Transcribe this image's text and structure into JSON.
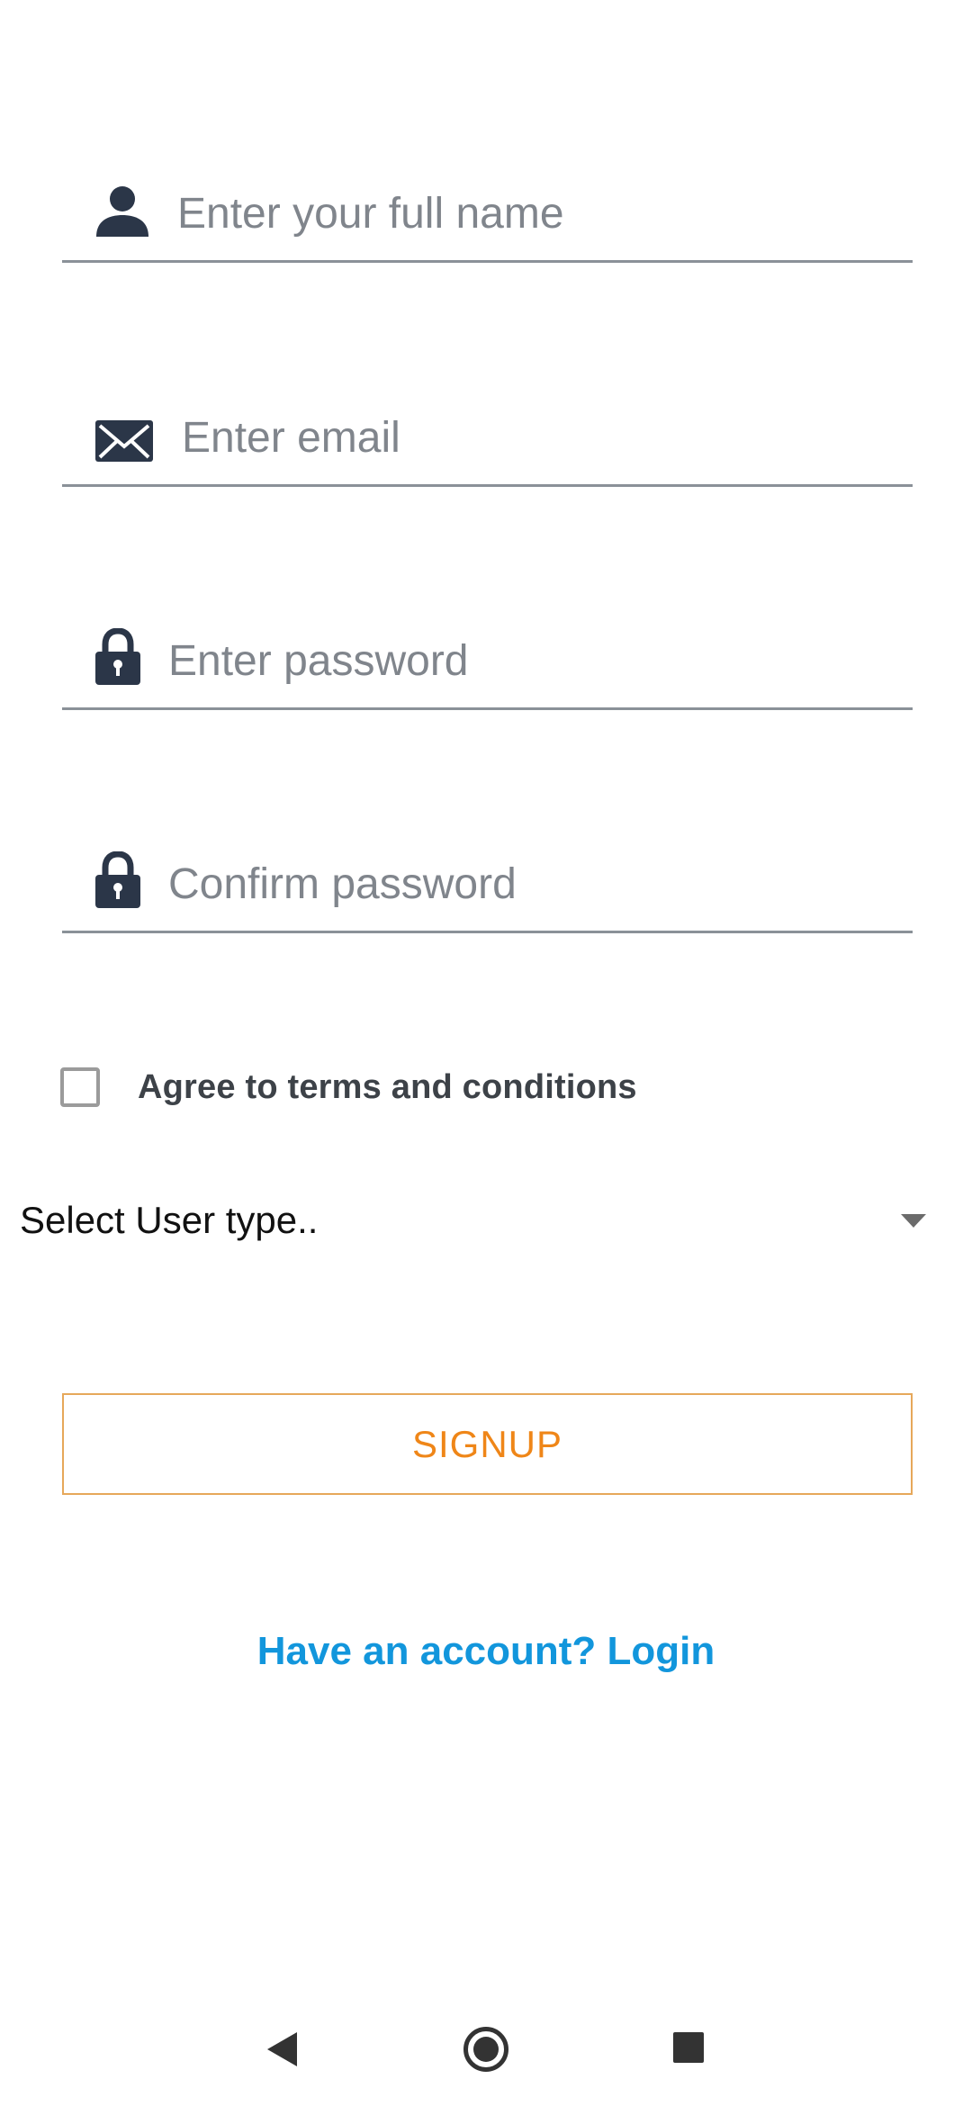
{
  "form": {
    "full_name": {
      "placeholder": "Enter your full name",
      "value": "",
      "icon": "person-icon"
    },
    "email": {
      "placeholder": "Enter email",
      "value": "",
      "icon": "envelope-icon"
    },
    "password": {
      "placeholder": "Enter password",
      "value": "",
      "icon": "lock-icon"
    },
    "confirm_password": {
      "placeholder": "Confirm password",
      "value": "",
      "icon": "lock-icon"
    },
    "terms": {
      "label": "Agree to terms and conditions",
      "checked": false
    },
    "user_type": {
      "selected": "Select User type..",
      "icon": "caret-down-icon"
    },
    "signup_label": "SIGNUP",
    "login_link": "Have an account? Login"
  },
  "colors": {
    "icon": "#2b3648",
    "underline": "#8a9198",
    "signup_text": "#ef8618",
    "signup_border": "#e6a85a",
    "link": "#1296dc"
  },
  "navbar": {
    "back_icon": "back-triangle-icon",
    "home_icon": "home-circle-icon",
    "recents_icon": "recents-square-icon"
  }
}
